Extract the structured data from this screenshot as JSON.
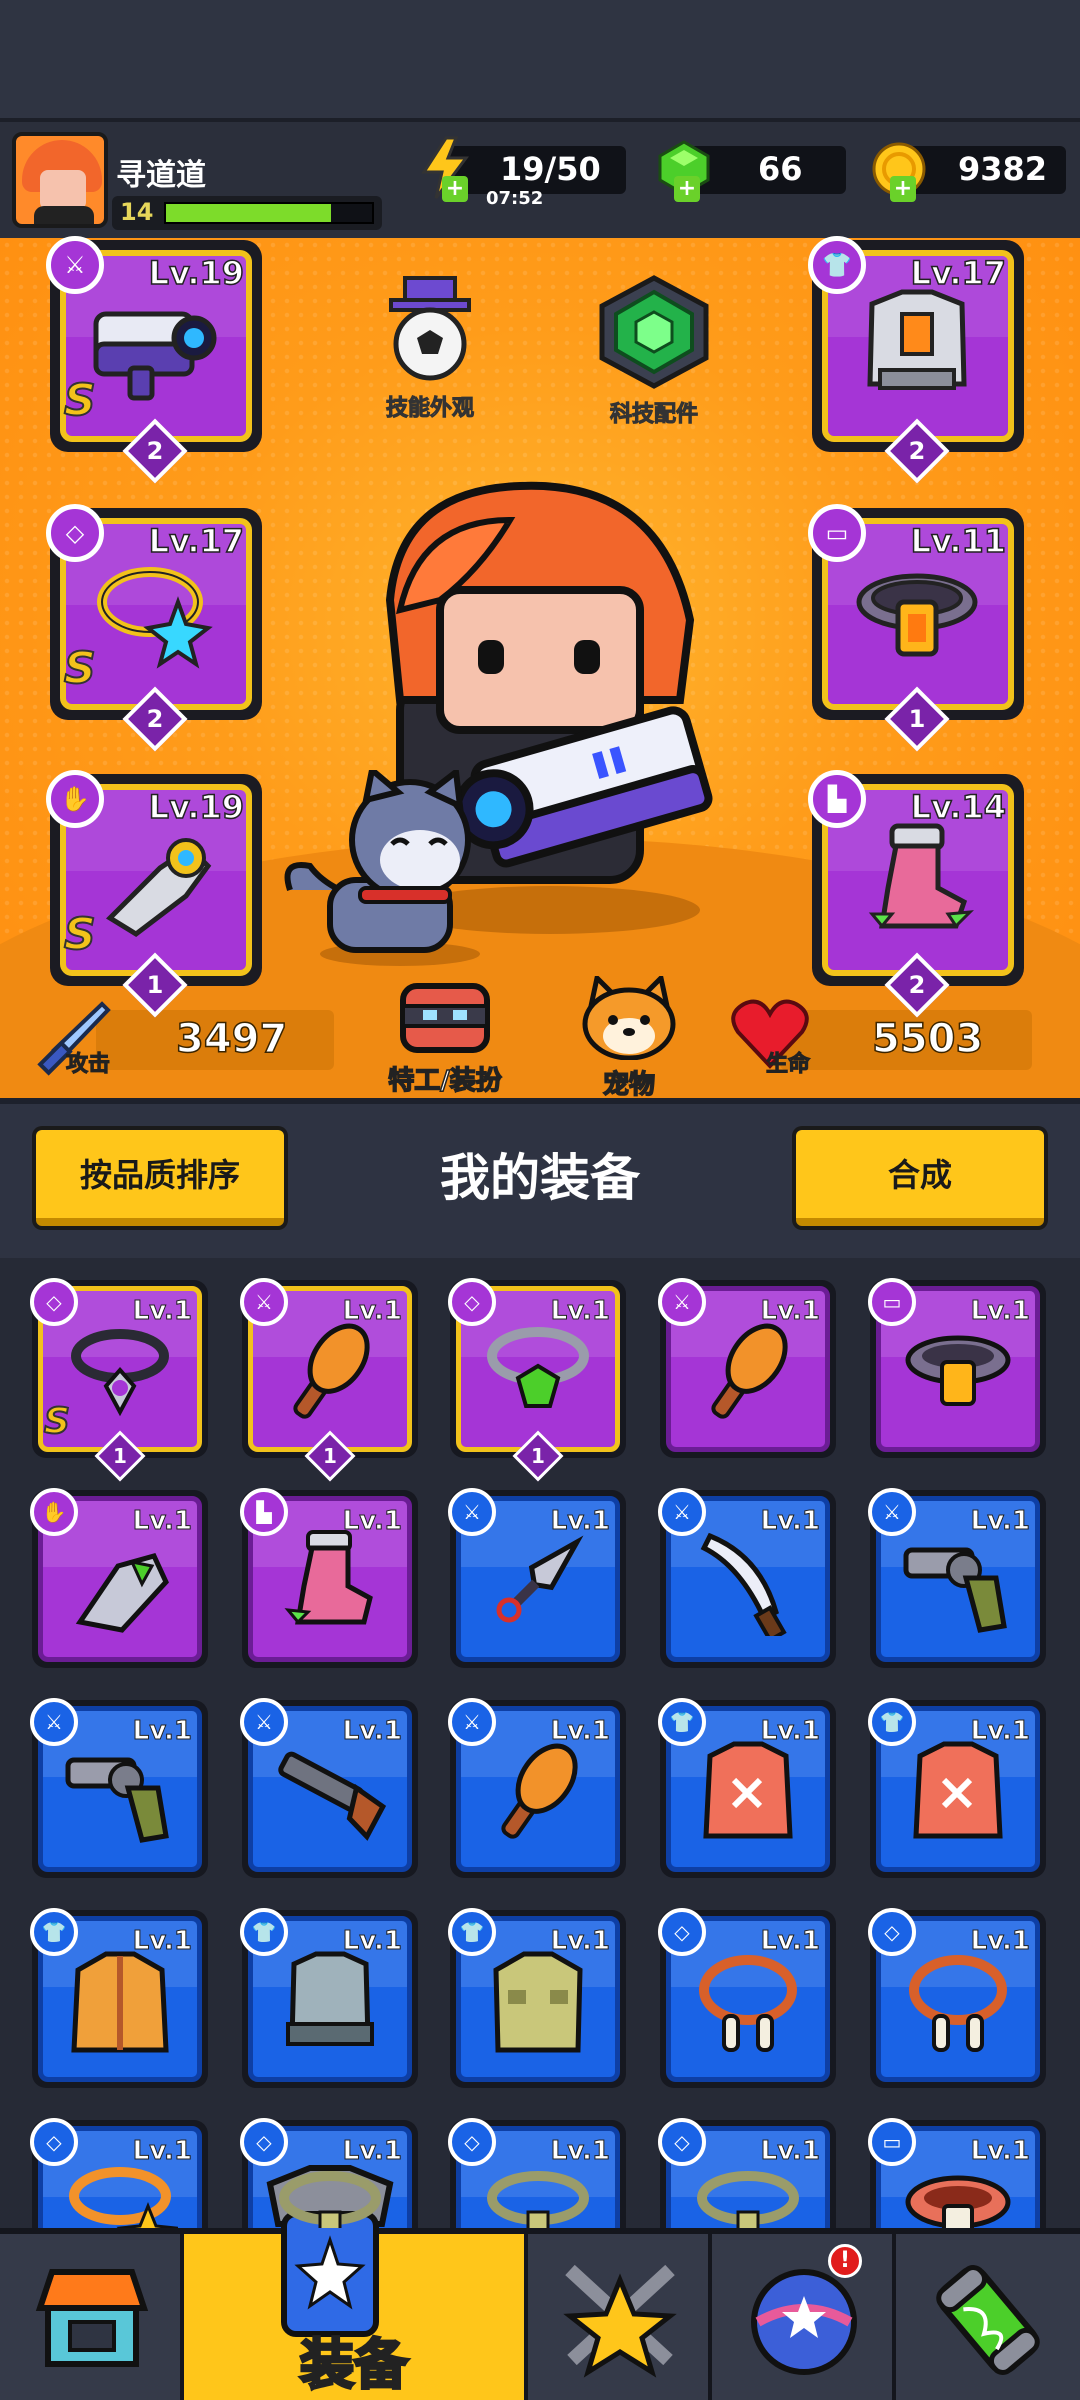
{
  "player": {
    "name": "寻道道",
    "level": "14",
    "xp_fraction": 0.8
  },
  "resources": {
    "energy": "19/50",
    "energy_timer": "07:52",
    "gems": "66",
    "coins": "9382"
  },
  "hero_slots": [
    {
      "slot": "weapon",
      "level": "Lv.19",
      "grade": "S",
      "count": "2",
      "icon": "weapon-type-icon"
    },
    {
      "slot": "armor",
      "level": "Lv.17",
      "grade": "",
      "count": "2",
      "icon": "armor-type-icon"
    },
    {
      "slot": "necklace",
      "level": "Lv.17",
      "grade": "S",
      "count": "2",
      "icon": "necklace-type-icon"
    },
    {
      "slot": "belt",
      "level": "Lv.11",
      "grade": "",
      "count": "1",
      "icon": "belt-type-icon"
    },
    {
      "slot": "gloves",
      "level": "Lv.19",
      "grade": "S",
      "count": "1",
      "icon": "glove-type-icon"
    },
    {
      "slot": "boots",
      "level": "Lv.14",
      "grade": "",
      "count": "2",
      "icon": "boot-type-icon"
    }
  ],
  "features": {
    "skill_skin": "技能外观",
    "tech_parts": "科技配件",
    "agent_outfit": "特工/装扮",
    "pet": "宠物"
  },
  "stats": {
    "attack_label": "攻击",
    "attack_value": "3497",
    "hp_label": "生命",
    "hp_value": "5503"
  },
  "equipment_section": {
    "sort_button": "按品质排序",
    "title": "我的装备",
    "merge_button": "合成"
  },
  "inventory": [
    {
      "level": "Lv.1",
      "rarity": "purple",
      "type": "necklace",
      "grade": "S",
      "count": "1",
      "item": "spiked-necklace"
    },
    {
      "level": "Lv.1",
      "rarity": "purple",
      "type": "weapon",
      "grade": "",
      "count": "1",
      "item": "wooden-club"
    },
    {
      "level": "Lv.1",
      "rarity": "purple",
      "type": "necklace",
      "grade": "",
      "count": "1",
      "item": "gem-necklace"
    },
    {
      "level": "Lv.1",
      "rarity": "purple",
      "type": "weapon",
      "grade": "",
      "count": "",
      "item": "wooden-club"
    },
    {
      "level": "Lv.1",
      "rarity": "purple",
      "type": "belt",
      "grade": "",
      "count": "",
      "item": "belt"
    },
    {
      "level": "Lv.1",
      "rarity": "purple",
      "type": "gloves",
      "grade": "",
      "count": "",
      "item": "gauntlet"
    },
    {
      "level": "Lv.1",
      "rarity": "purple",
      "type": "boots",
      "grade": "",
      "count": "",
      "item": "boots"
    },
    {
      "level": "Lv.1",
      "rarity": "blue",
      "type": "weapon",
      "grade": "",
      "count": "",
      "item": "kunai"
    },
    {
      "level": "Lv.1",
      "rarity": "blue",
      "type": "weapon",
      "grade": "",
      "count": "",
      "item": "machete"
    },
    {
      "level": "Lv.1",
      "rarity": "blue",
      "type": "weapon",
      "grade": "",
      "count": "",
      "item": "revolver"
    },
    {
      "level": "Lv.1",
      "rarity": "blue",
      "type": "weapon",
      "grade": "",
      "count": "",
      "item": "revolver"
    },
    {
      "level": "Lv.1",
      "rarity": "blue",
      "type": "weapon",
      "grade": "",
      "count": "",
      "item": "shotgun"
    },
    {
      "level": "Lv.1",
      "rarity": "blue",
      "type": "weapon",
      "grade": "",
      "count": "",
      "item": "wooden-club"
    },
    {
      "level": "Lv.1",
      "rarity": "blue",
      "type": "armor",
      "grade": "",
      "count": "",
      "item": "torn-vest"
    },
    {
      "level": "Lv.1",
      "rarity": "blue",
      "type": "armor",
      "grade": "",
      "count": "",
      "item": "torn-vest"
    },
    {
      "level": "Lv.1",
      "rarity": "blue",
      "type": "armor",
      "grade": "",
      "count": "",
      "item": "jacket"
    },
    {
      "level": "Lv.1",
      "rarity": "blue",
      "type": "armor",
      "grade": "",
      "count": "",
      "item": "body-armor"
    },
    {
      "level": "Lv.1",
      "rarity": "blue",
      "type": "armor",
      "grade": "",
      "count": "",
      "item": "shirt"
    },
    {
      "level": "Lv.1",
      "rarity": "blue",
      "type": "necklace",
      "grade": "",
      "count": "",
      "item": "bone-necklace"
    },
    {
      "level": "Lv.1",
      "rarity": "blue",
      "type": "necklace",
      "grade": "",
      "count": "",
      "item": "bone-necklace"
    },
    {
      "level": "Lv.1",
      "rarity": "blue",
      "type": "necklace",
      "grade": "",
      "count": "",
      "item": "star-necklace"
    },
    {
      "level": "Lv.1",
      "rarity": "blue",
      "type": "necklace",
      "grade": "",
      "count": "",
      "item": "plain-necklace"
    },
    {
      "level": "Lv.1",
      "rarity": "blue",
      "type": "necklace",
      "grade": "",
      "count": "",
      "item": "plain-necklace"
    },
    {
      "level": "Lv.1",
      "rarity": "blue",
      "type": "necklace",
      "grade": "",
      "count": "",
      "item": "plain-necklace"
    },
    {
      "level": "Lv.1",
      "rarity": "blue",
      "type": "belt",
      "grade": "",
      "count": "",
      "item": "leather-belt"
    }
  ],
  "nav": {
    "equipment": "装备",
    "notification": "!"
  },
  "colors": {
    "purple_rarity": "#a535d6",
    "blue_rarity": "#1a63e6",
    "gold_frame": "#f2c21b",
    "stage_orange": "#ff9c1a",
    "button_yellow": "#ffc61a"
  }
}
